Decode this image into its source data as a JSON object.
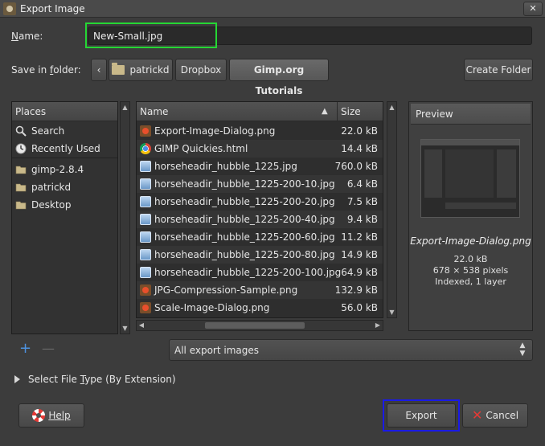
{
  "window": {
    "title": "Export Image",
    "close_icon": "close-icon"
  },
  "name_field": {
    "label": "Name:",
    "value": "New-Small.jpg"
  },
  "save_in": {
    "label": "Save in folder:",
    "back_glyph": "‹",
    "breadcrumbs": [
      "patrickd",
      "Dropbox",
      "Gimp.org Tutorials"
    ],
    "create_folder": "Create Folder"
  },
  "places": {
    "header": "Places",
    "items": [
      {
        "label": "Search",
        "icon": "search-icon"
      },
      {
        "label": "Recently Used",
        "icon": "recent-icon"
      },
      {
        "label": "gimp-2.8.4",
        "icon": "folder-icon"
      },
      {
        "label": "patrickd",
        "icon": "folder-icon"
      },
      {
        "label": "Desktop",
        "icon": "folder-icon"
      }
    ]
  },
  "files": {
    "columns": {
      "name": "Name",
      "size": "Size"
    },
    "rows": [
      {
        "name": "Export-Image-Dialog.png",
        "size": "22.0 kB",
        "type": "gimp"
      },
      {
        "name": "GIMP Quickies.html",
        "size": "14.4 kB",
        "type": "chrome"
      },
      {
        "name": "horseheadir_hubble_1225.jpg",
        "size": "760.0 kB",
        "type": "jpg"
      },
      {
        "name": "horseheadir_hubble_1225-200-10.jpg",
        "size": "6.4 kB",
        "type": "jpg"
      },
      {
        "name": "horseheadir_hubble_1225-200-20.jpg",
        "size": "7.5 kB",
        "type": "jpg"
      },
      {
        "name": "horseheadir_hubble_1225-200-40.jpg",
        "size": "9.4 kB",
        "type": "jpg"
      },
      {
        "name": "horseheadir_hubble_1225-200-60.jpg",
        "size": "11.2 kB",
        "type": "jpg"
      },
      {
        "name": "horseheadir_hubble_1225-200-80.jpg",
        "size": "14.9 kB",
        "type": "jpg"
      },
      {
        "name": "horseheadir_hubble_1225-200-100.jpg",
        "size": "64.9 kB",
        "type": "jpg"
      },
      {
        "name": "JPG-Compression-Sample.png",
        "size": "132.9 kB",
        "type": "gimp"
      },
      {
        "name": "Scale-Image-Dialog.png",
        "size": "56.0 kB",
        "type": "gimp"
      }
    ]
  },
  "preview": {
    "header": "Preview",
    "filename": "Export-Image-Dialog.png",
    "size": "22.0 kB",
    "dimensions": "678 × 538 pixels",
    "mode": "Indexed, 1 layer"
  },
  "filter": {
    "value": "All export images"
  },
  "file_type_expander": {
    "label": "Select File Type (By Extension)"
  },
  "buttons": {
    "help": "Help",
    "export": "Export",
    "cancel": "Cancel"
  },
  "colors": {
    "name_highlight": "#25d634",
    "export_highlight": "#1a1ae6",
    "background": "#3c3c3c"
  }
}
